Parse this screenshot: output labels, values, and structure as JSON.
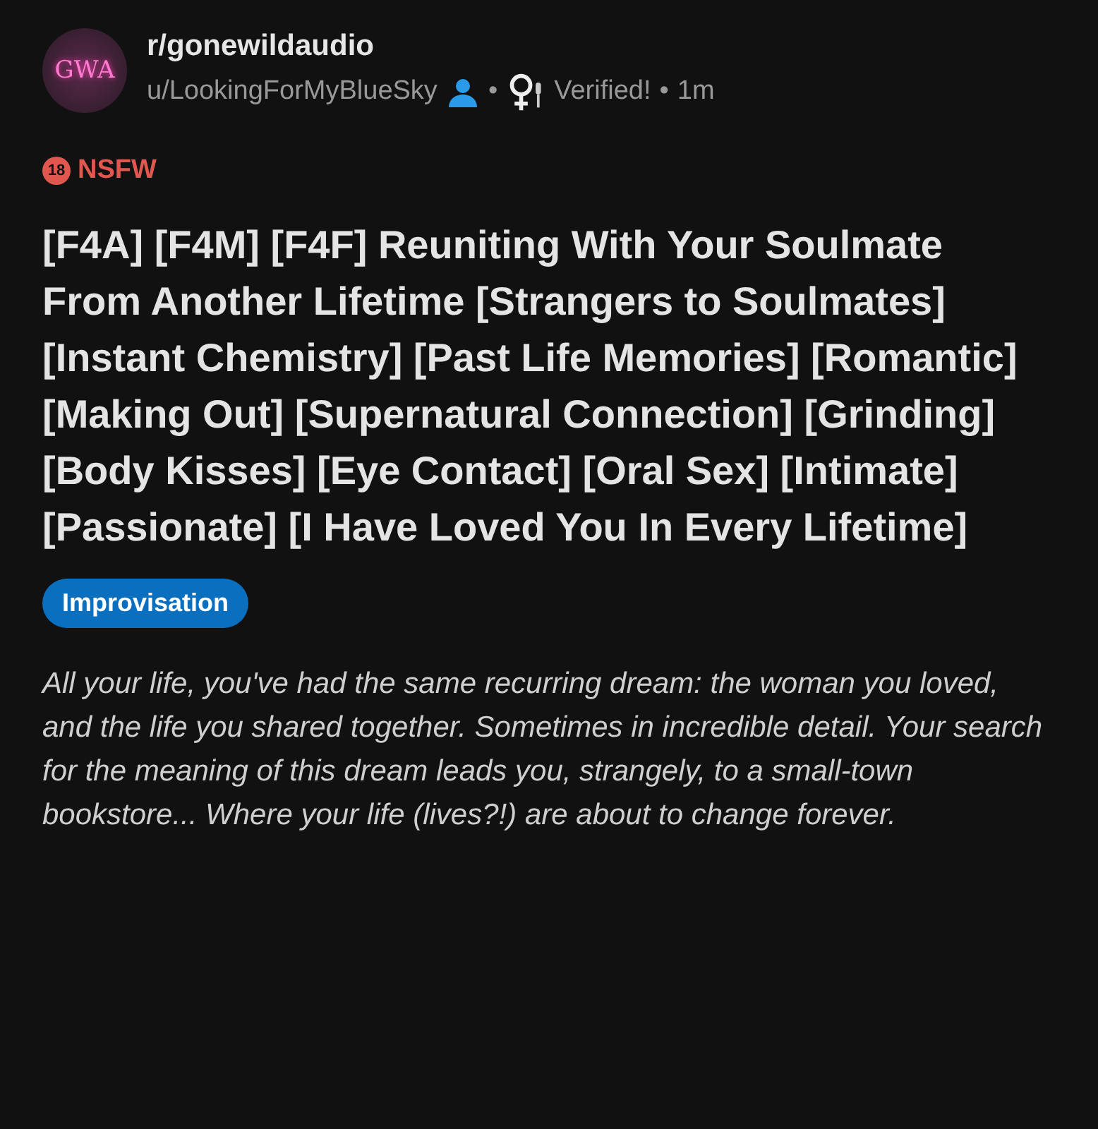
{
  "post": {
    "avatar_text": "GWA",
    "subreddit": "r/gonewildaudio",
    "author": "u/LookingForMyBlueSky",
    "separator_1": "•",
    "flair": "Verified!",
    "separator_2": "•",
    "time": "1m",
    "nsfw": {
      "age": "18",
      "label": "NSFW"
    },
    "title": "[F4A] [F4M] [F4F] Reuniting With Your Soulmate From Another Lifetime [Strangers to Soulmates] [Instant Chemistry] [Past Life Memories] [Romantic] [Making Out] [Supernatural Connection] [Grinding] [Body Kisses] [Eye Contact] [Oral Sex] [Intimate] [Passionate] [I Have Loved You In Every Lifetime]",
    "tag": "Improvisation",
    "body": "All your life, you've had the same recurring dream: the woman you loved, and the life you shared together. Sometimes in incredible detail. Your search for the meaning of this dream leads you, strangely, to a small-town bookstore... Where your life (lives?!) are about to change forever."
  }
}
